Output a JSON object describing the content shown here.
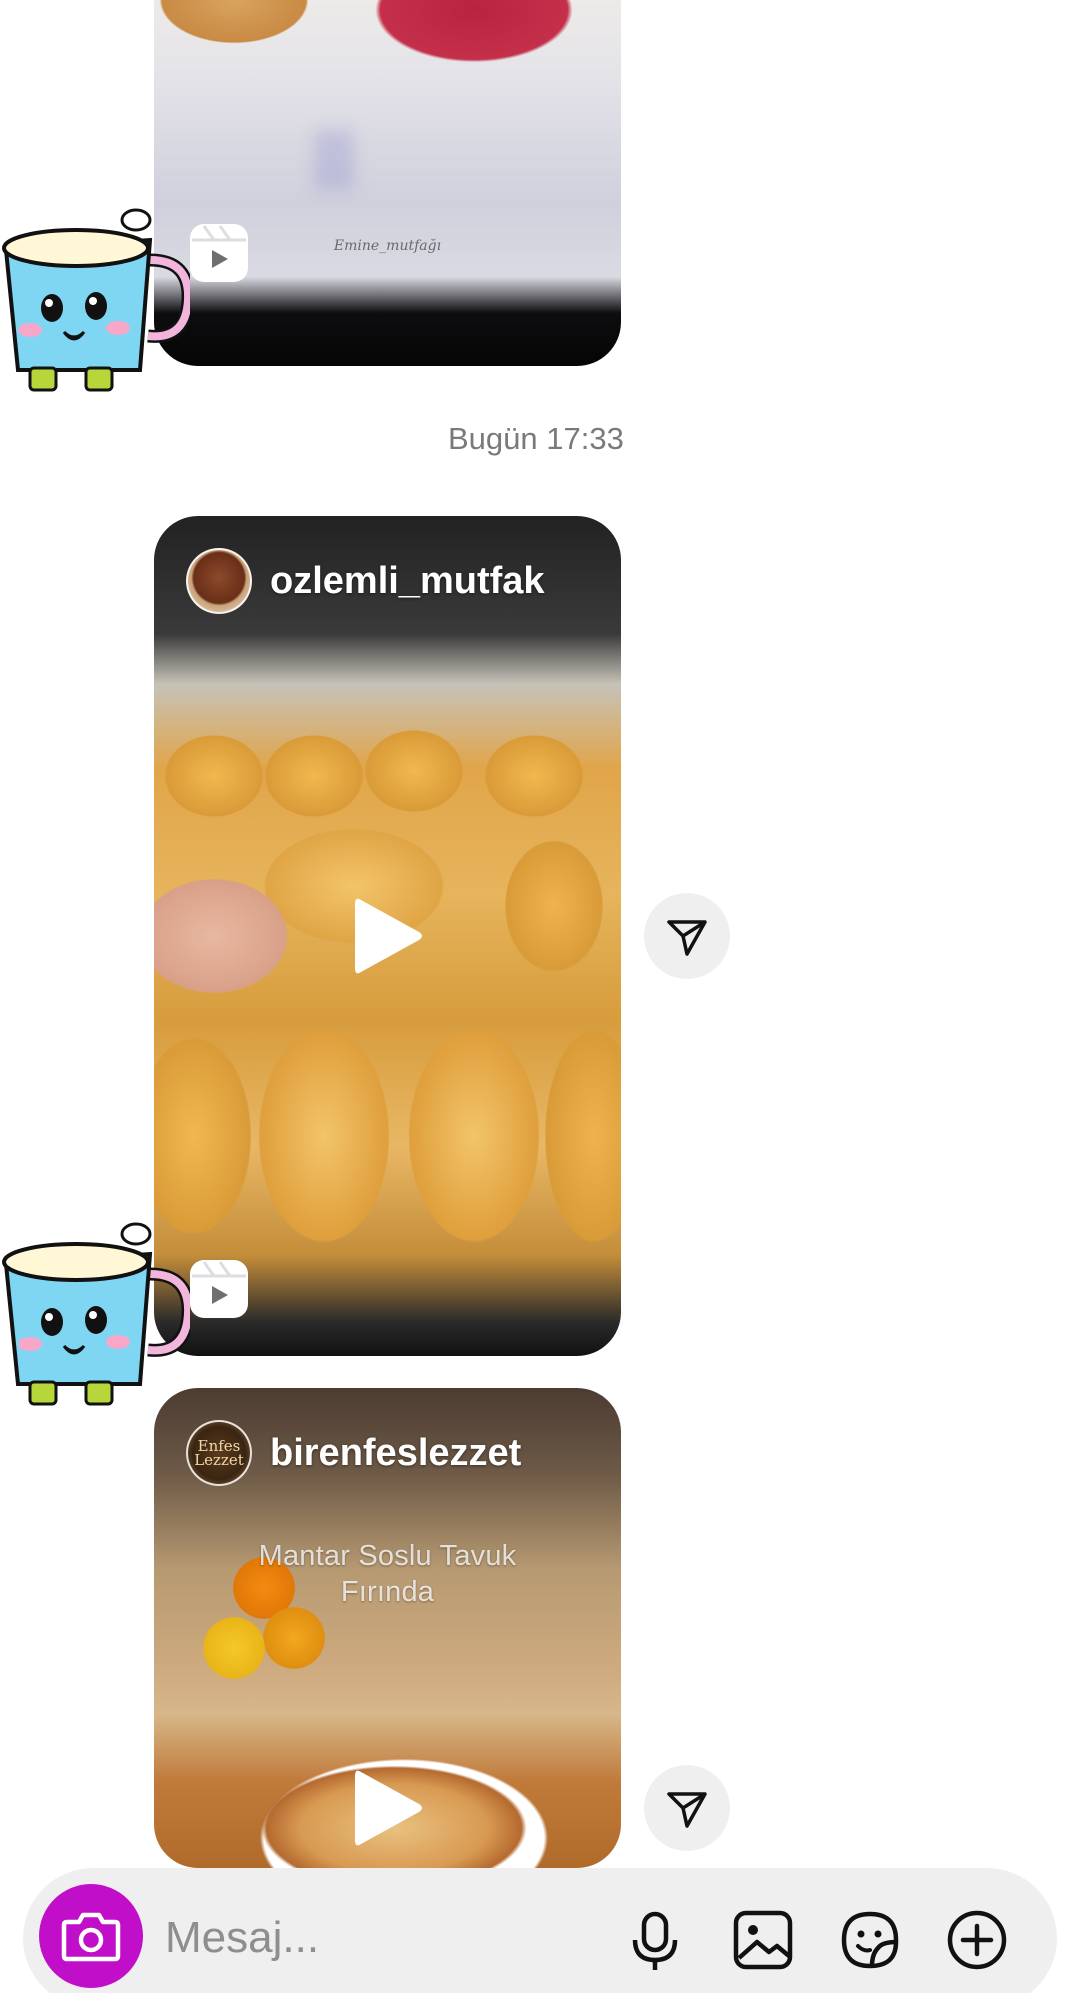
{
  "timestamp": "Bugün 17:33",
  "messages": [
    {
      "type": "reel",
      "watermark": "Emine_mutfağı",
      "badge_icon": "reels-icon"
    },
    {
      "type": "reel",
      "username": "ozlemli_mutfak",
      "avatar_icon": "profile-avatar",
      "play_icon": "play-icon",
      "badge_icon": "reels-icon",
      "forward_icon": "send-icon"
    },
    {
      "type": "reel",
      "username": "birenfeslezzet",
      "avatar_text": "Enfes Lezzet",
      "caption_line1": "Mantar Soslu Tavuk",
      "caption_line2": "Fırında",
      "play_icon": "play-icon",
      "forward_icon": "send-icon"
    }
  ],
  "composer": {
    "placeholder": "Mesaj...",
    "camera_icon": "camera-icon",
    "mic_icon": "microphone-icon",
    "gallery_icon": "image-icon",
    "sticker_icon": "sticker-icon",
    "more_icon": "plus-circle-icon",
    "camera_color": "#c10fc9"
  },
  "colors": {
    "background": "#ffffff",
    "timestamp": "#7a7a7a",
    "composer_bg": "#efefef"
  }
}
